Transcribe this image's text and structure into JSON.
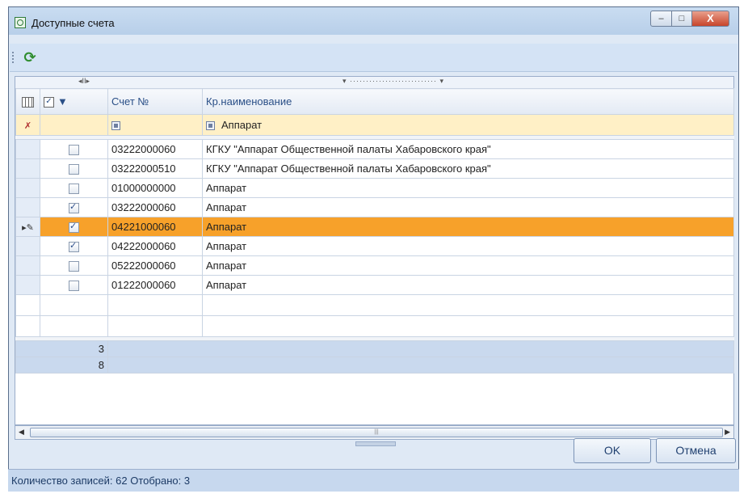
{
  "window": {
    "title": "Доступные счета",
    "close_glyph": "X",
    "min_glyph": "–",
    "max_glyph": "□"
  },
  "toolbar": {
    "refresh_icon": "refresh-icon"
  },
  "grid": {
    "band_left": "◂II▸",
    "band_right": "▾ ··························· ▾",
    "headers": {
      "account": "Счет №",
      "short_name": "Кр.наименование"
    },
    "filter": {
      "short_name": "Аппарат"
    },
    "rows": [
      {
        "checked": false,
        "account": "03222000060",
        "name": "КГКУ \"Аппарат Общественной палаты Хабаровского края\"",
        "selected": false
      },
      {
        "checked": false,
        "account": "03222000510",
        "name": "КГКУ \"Аппарат Общественной палаты Хабаровского края\"",
        "selected": false
      },
      {
        "checked": false,
        "account": "01000000000",
        "name": "Аппарат",
        "selected": false
      },
      {
        "checked": true,
        "account": "03222000060",
        "name": "Аппарат",
        "selected": false
      },
      {
        "checked": true,
        "account": "04221000060",
        "name": "Аппарат",
        "selected": true
      },
      {
        "checked": true,
        "account": "04222000060",
        "name": "Аппарат",
        "selected": false
      },
      {
        "checked": false,
        "account": "05222000060",
        "name": "Аппарат",
        "selected": false
      },
      {
        "checked": false,
        "account": "01222000060",
        "name": "Аппарат",
        "selected": false
      }
    ],
    "footer": {
      "checked_count": "3",
      "row_count": "8"
    }
  },
  "buttons": {
    "ok": "OK",
    "cancel": "Отмена"
  },
  "status": {
    "text": "Количество записей: 62  Отобрано: 3"
  },
  "colors": {
    "selected_row": "#f7a12a",
    "filter_row": "#fff0c6",
    "title_bar": "#c9dcf1"
  }
}
